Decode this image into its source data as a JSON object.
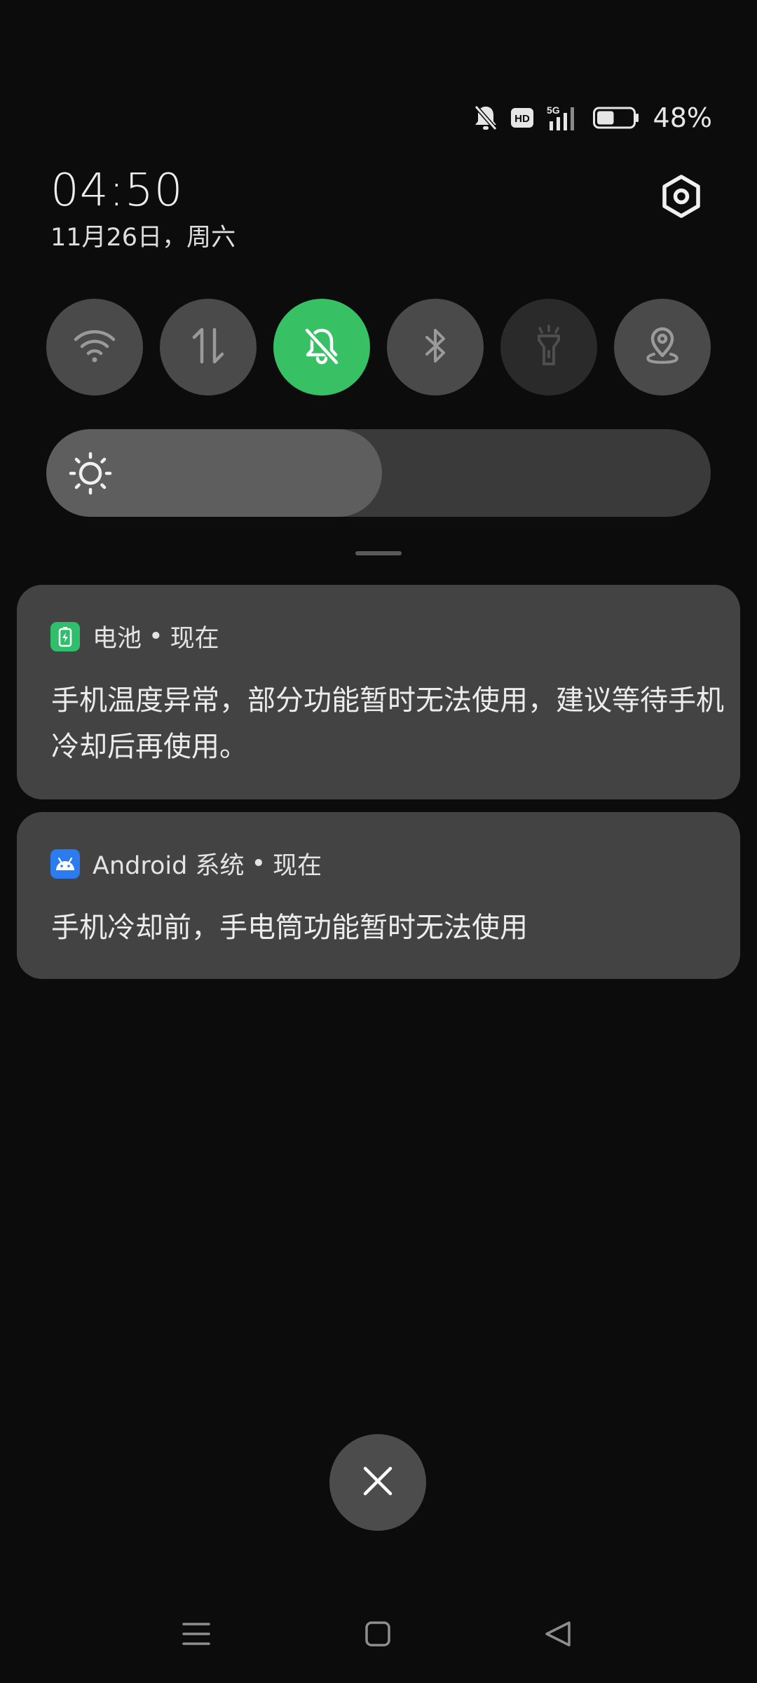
{
  "status_bar": {
    "icons": [
      "bell-off-icon",
      "hd-icon",
      "5g-signal-icon",
      "battery-icon"
    ],
    "battery_percent": "48%",
    "battery_level": 0.48
  },
  "header": {
    "time": "04:50",
    "date": "11月26日，周六"
  },
  "quick_tiles": [
    {
      "name": "wifi",
      "icon": "wifi-icon",
      "state": "off"
    },
    {
      "name": "mobile-data",
      "icon": "data-arrows-icon",
      "state": "off"
    },
    {
      "name": "silent",
      "icon": "bell-off-icon",
      "state": "on"
    },
    {
      "name": "bluetooth",
      "icon": "bluetooth-icon",
      "state": "off"
    },
    {
      "name": "flashlight",
      "icon": "flashlight-icon",
      "state": "disabled"
    },
    {
      "name": "location",
      "icon": "location-pin-icon",
      "state": "off"
    }
  ],
  "brightness": {
    "level": 0.505,
    "icon": "sun-icon"
  },
  "notifications": [
    {
      "app": "电池",
      "separator": "•",
      "time": "现在",
      "body": "手机温度异常，部分功能暂时无法使用，建议等待手机冷却后再使用。",
      "icon": "battery-app-icon",
      "icon_color": "#2fbf6a"
    },
    {
      "app": "Android 系统",
      "separator": "•",
      "time": "现在",
      "body": "手机冷却前，手电筒功能暂时无法使用",
      "icon": "android-icon",
      "icon_color": "#2a7cf0"
    }
  ],
  "colors": {
    "accent_active": "#37c064",
    "tile_inactive": "#4a4a4a",
    "card": "#434343",
    "background": "#0c0c0c"
  },
  "nav_bar": [
    "menu-icon",
    "home-icon",
    "back-icon"
  ]
}
